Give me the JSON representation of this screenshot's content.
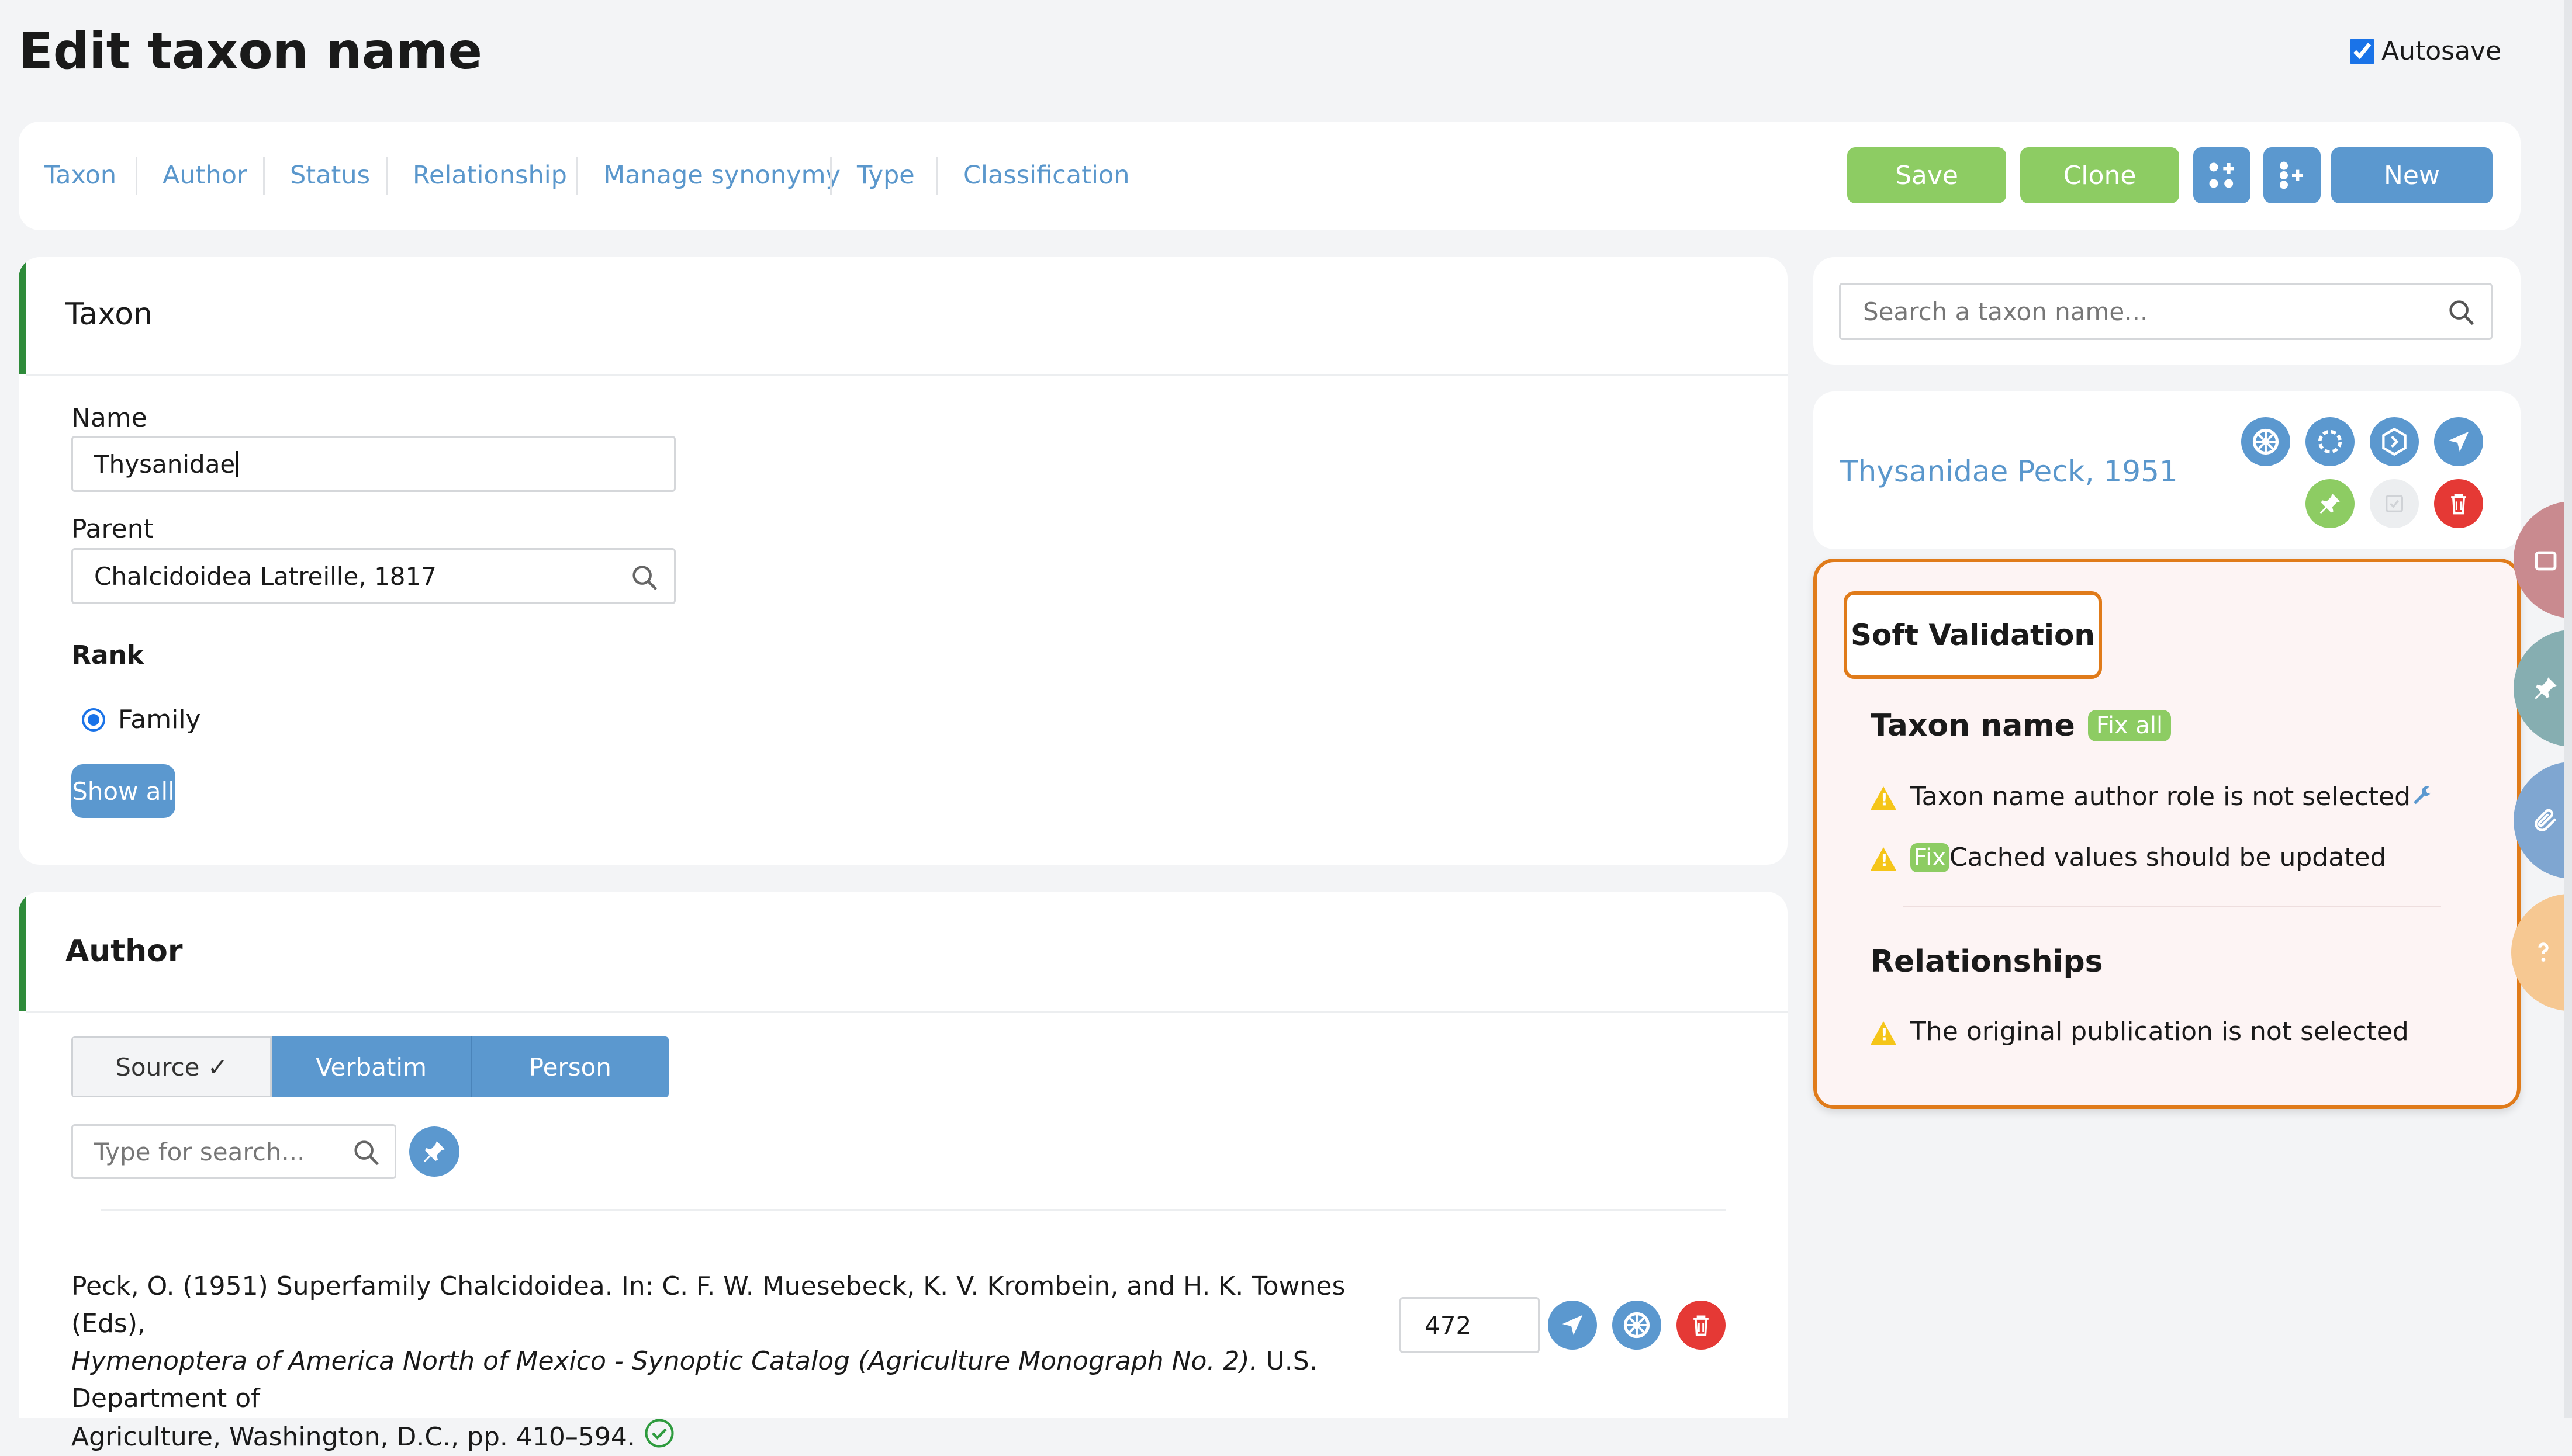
{
  "page": {
    "title": "Edit taxon name",
    "autosave_label": "Autosave",
    "autosave_checked": true
  },
  "nav": {
    "tabs": [
      "Taxon",
      "Author",
      "Status",
      "Relationship",
      "Manage synonymy",
      "Type",
      "Classification"
    ],
    "buttons": {
      "save": "Save",
      "clone": "Clone",
      "new": "New"
    }
  },
  "taxon_section": {
    "heading": "Taxon",
    "name_label": "Name",
    "name_value": "Thysanidae",
    "parent_label": "Parent",
    "parent_value": "Chalcidoidea Latreille, 1817",
    "rank_label": "Rank",
    "rank_option": "Family",
    "show_all": "Show all"
  },
  "author_section": {
    "heading": "Author",
    "toggles": [
      "Source ✓",
      "Verbatim",
      "Person"
    ],
    "search_placeholder": "Type for search...",
    "citation_line1": "Peck, O. (1951) Superfamily Chalcidoidea. In: C. F. W. Muesebeck, K. V. Krombein, and H. K. Townes (Eds),",
    "citation_italic": "Hymenoptera of America North of Mexico - Synoptic Catalog (Agriculture Monograph No. 2).",
    "citation_line2_rest": " U.S. Department of",
    "citation_line3": "Agriculture, Washington, D.C., pp. 410–594.",
    "page_value": "472"
  },
  "sidebar": {
    "search_placeholder": "Search a taxon name...",
    "taxon_label": "Thysanidae Peck, 1951",
    "soft_validation": {
      "title": "Soft Validation",
      "group1_title": "Taxon name",
      "fix_all": "Fix all",
      "fix": "Fix",
      "msg1": "Taxon name author role is not selected",
      "msg2": "Cached values should be updated",
      "group2_title": "Relationships",
      "msg3": "The original publication is not selected"
    }
  },
  "colors": {
    "accent_blue": "#5b98cf",
    "accent_green": "#8dcc63",
    "delete_red": "#e53935",
    "validation_orange": "#e07b1a",
    "warning_yellow": "#f5c518"
  }
}
